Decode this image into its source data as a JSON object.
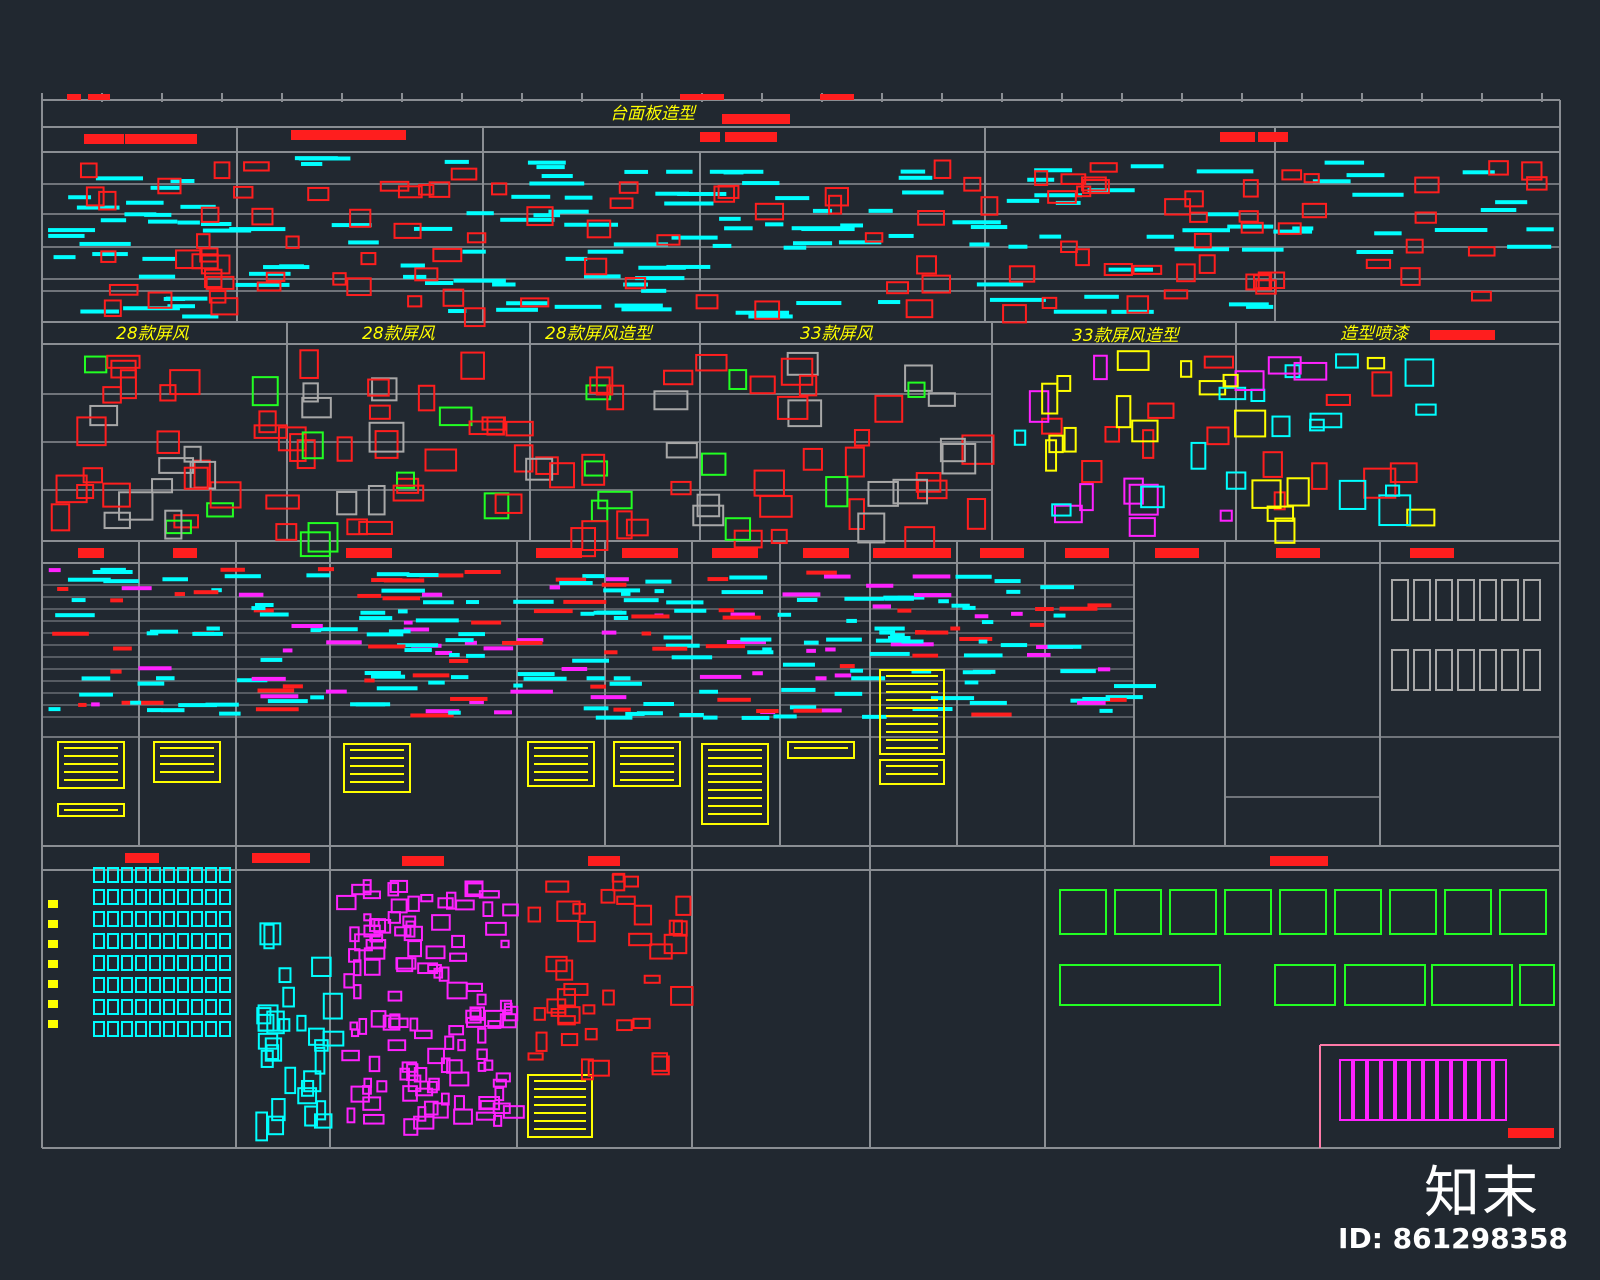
{
  "sheet": {
    "main_title": "台面板造型",
    "section_titles": {
      "s1": "28款屏风",
      "s2": "28款屏风",
      "s3": "28款屏风造型",
      "s4": "33款屏风",
      "s5": "33款屏风造型",
      "s6": "造型喷漆"
    }
  },
  "watermark": {
    "brand": "知末",
    "id_text": "ID: 861298358"
  },
  "colors": {
    "background": "#212830",
    "frame": "#8a8e93",
    "cyan": "#00ffff",
    "red": "#ff1e1e",
    "yellow": "#ffff00",
    "magenta": "#ff22ff",
    "green": "#22ff22",
    "gray": "#a8a8a8"
  }
}
